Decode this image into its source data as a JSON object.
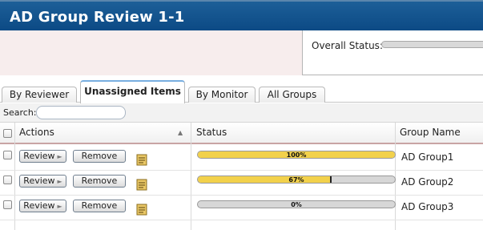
{
  "page": {
    "title": "AD Group Review 1-1"
  },
  "overall_status": {
    "label": "Overall Status:"
  },
  "tabs": [
    {
      "label": "By Reviewer",
      "active": false
    },
    {
      "label": "Unassigned Items",
      "active": true
    },
    {
      "label": "By Monitor",
      "active": false
    },
    {
      "label": "All Groups",
      "active": false
    }
  ],
  "search": {
    "label": "Search:",
    "value": ""
  },
  "columns": {
    "actions": "Actions",
    "status": "Status",
    "group_name": "Group Name"
  },
  "buttons": {
    "review": "Review",
    "remove": "Remove"
  },
  "rows": [
    {
      "group": "AD Group1",
      "progress": 1.0,
      "progress_text": "100%"
    },
    {
      "group": "AD Group2",
      "progress": 0.67,
      "progress_text": "67%"
    },
    {
      "group": "AD Group3",
      "progress": 0.0,
      "progress_text": "0%"
    }
  ],
  "colors": {
    "titlebar": "#0c4a85",
    "progress_fill": "#f2d14b",
    "header_band": "#f7eded"
  }
}
